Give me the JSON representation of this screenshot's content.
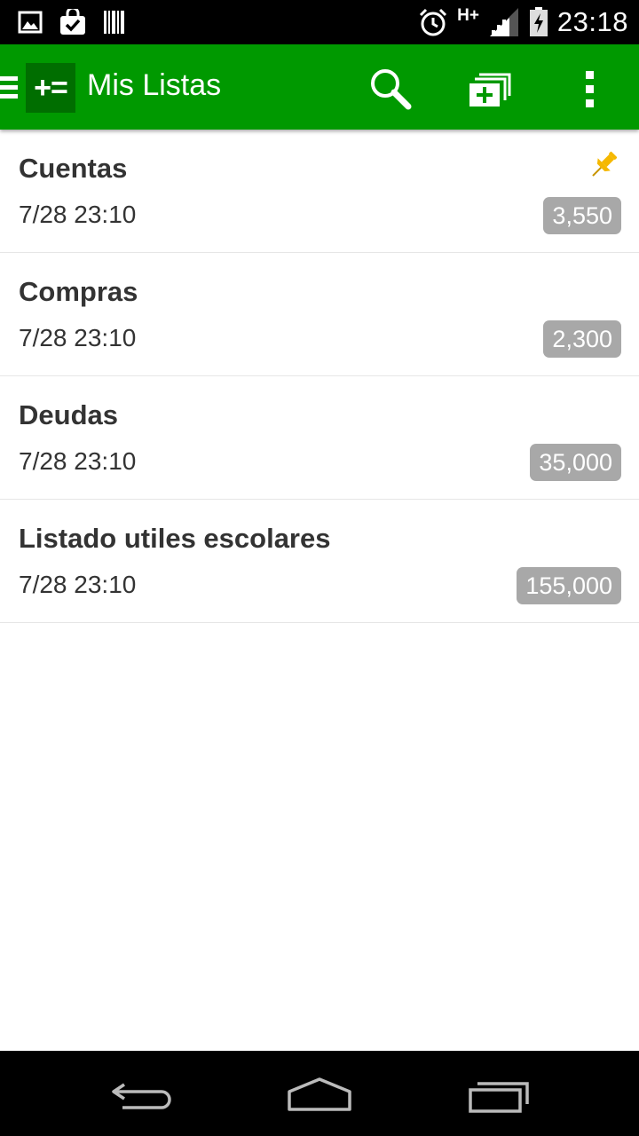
{
  "status_bar": {
    "time": "23:18",
    "network": "H+",
    "left_icons": [
      "image-notification-icon",
      "shopping-bag-check-icon",
      "barcode-icon"
    ],
    "right_icons": [
      "alarm-icon",
      "signal-icon",
      "battery-charging-icon"
    ]
  },
  "app_bar": {
    "logo_text": "+=",
    "title": "Mis Listas",
    "actions": [
      "search-icon",
      "add-copy-icon",
      "overflow-menu-icon"
    ]
  },
  "lists": [
    {
      "title": "Cuentas",
      "date": "7/28 23:10",
      "total": "3,550",
      "pinned": true
    },
    {
      "title": "Compras",
      "date": "7/28 23:10",
      "total": "2,300",
      "pinned": false
    },
    {
      "title": "Deudas",
      "date": "7/28 23:10",
      "total": "35,000",
      "pinned": false
    },
    {
      "title": "Listado utiles escolares",
      "date": "7/28 23:10",
      "total": "155,000",
      "pinned": false
    }
  ],
  "colors": {
    "app_bar": "#009900",
    "logo_bg": "#006e00",
    "badge": "#a8a8a8",
    "pin": "#f5b800",
    "text": "#333333"
  },
  "nav_bar": {
    "buttons": [
      "back-icon",
      "home-icon",
      "recents-icon"
    ]
  }
}
